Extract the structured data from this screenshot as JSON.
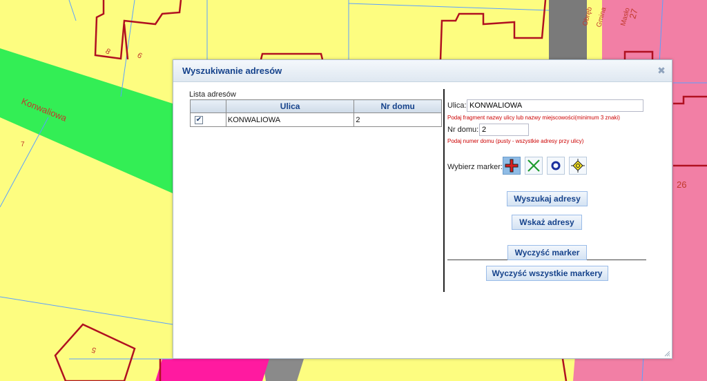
{
  "map": {
    "labels": {
      "street": "Konwaliowa",
      "n7": "7",
      "n8": "8",
      "n6": "6",
      "n5": "5",
      "n26": "26",
      "n27": "27",
      "street2a": "Obręb",
      "street2b": "Gmina",
      "street3": "Masło"
    }
  },
  "dialog": {
    "title": "Wyszukiwanie adresów",
    "close_glyph": "✖",
    "list": {
      "caption": "Lista adresów",
      "columns": [
        "",
        "Ulica",
        "Nr domu"
      ],
      "rows": [
        {
          "checked": "✔",
          "street": "KONWALIOWA",
          "number": "2"
        }
      ]
    },
    "form": {
      "street_label": "Ulica:",
      "street_value": "KONWALIOWA",
      "street_hint": "Podaj fragment nazwy ulicy lub nazwy miejscowości(minimum 3 znaki)",
      "number_label": "Nr domu:",
      "number_value": "2",
      "number_hint": "Podaj numer domu (pusty - wszystkie adresy przy ulicy)",
      "marker_label": "Wybierz marker:",
      "markers": [
        "red-cross-marker-icon",
        "green-x-marker-icon",
        "blue-circle-marker-icon",
        "yellow-crosshair-marker-icon"
      ]
    },
    "buttons": {
      "search": "Wyszukaj adresy",
      "show": "Wskaż adresy",
      "clear": "Wyczyść marker",
      "clear_all": "Wyczyść wszystkie markery"
    }
  },
  "colors": {
    "accent": "#15428b",
    "hint": "#cc0000",
    "map_yellow": "#fdfd80",
    "map_green": "#33ee55",
    "map_pink": "#f27fa5",
    "map_gray": "#7a7a7a",
    "parcel_red": "#b01020"
  }
}
